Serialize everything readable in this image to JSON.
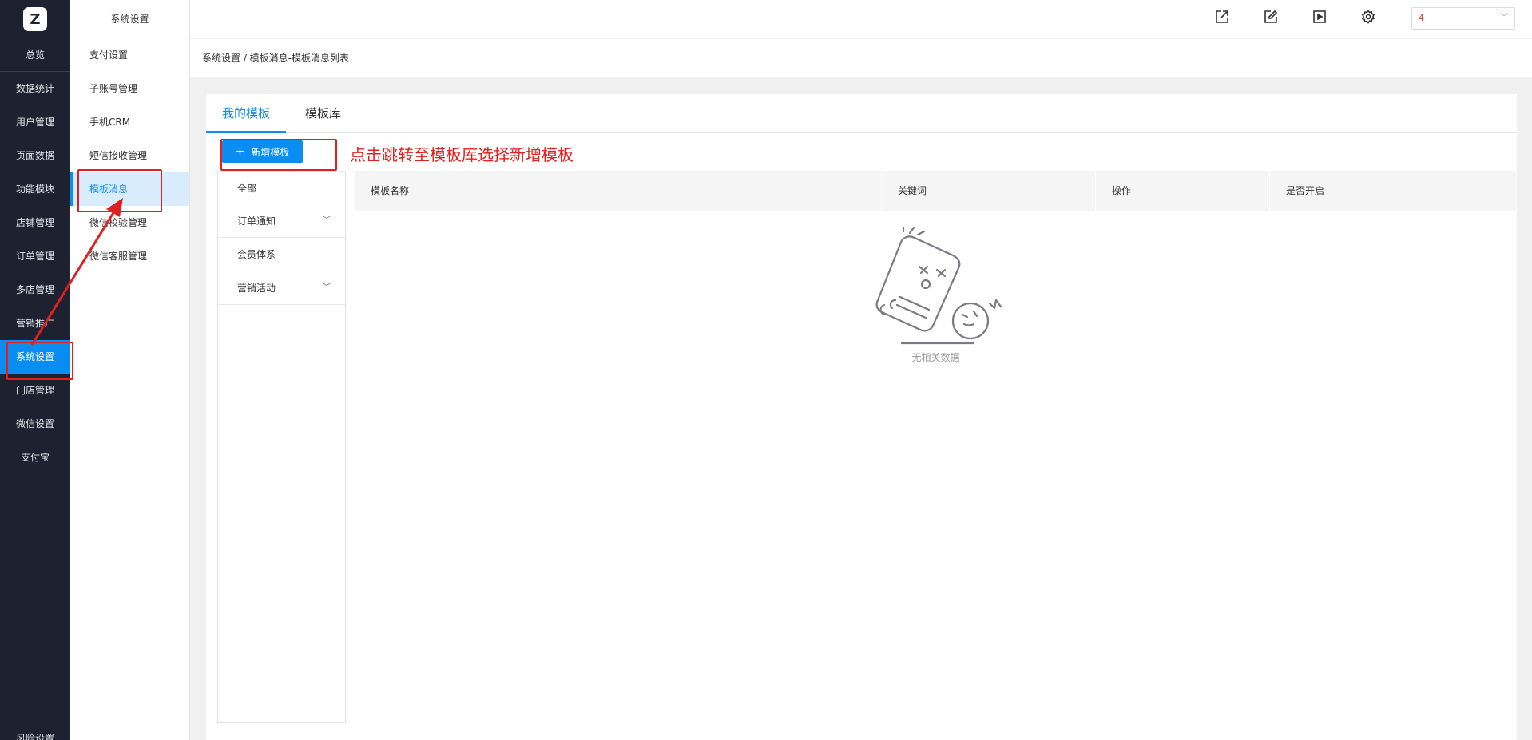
{
  "main_nav": {
    "logo_letter": "Z",
    "items": [
      {
        "label": "总览"
      },
      {
        "label": "数据统计"
      },
      {
        "label": "用户管理"
      },
      {
        "label": "页面数据"
      },
      {
        "label": "功能模块"
      },
      {
        "label": "店铺管理"
      },
      {
        "label": "订单管理"
      },
      {
        "label": "多店管理"
      },
      {
        "label": "营销推广"
      },
      {
        "label": "系统设置"
      },
      {
        "label": "门店管理"
      },
      {
        "label": "微信设置"
      },
      {
        "label": "支付宝"
      }
    ],
    "bottom_label": "风险设置"
  },
  "sub_nav": {
    "title": "系统设置",
    "items": [
      {
        "label": "支付设置"
      },
      {
        "label": "子账号管理"
      },
      {
        "label": "手机CRM"
      },
      {
        "label": "短信接收管理"
      },
      {
        "label": "模板消息"
      },
      {
        "label": "微信校验管理"
      },
      {
        "label": "微信客服管理"
      }
    ]
  },
  "header": {
    "icons": [
      "external-link-icon",
      "edit-icon",
      "play-icon",
      "gear-icon"
    ],
    "store_select_value": "4"
  },
  "breadcrumb": "系统设置 / 模板消息-模板消息列表",
  "tabs": [
    {
      "label": "我的模板"
    },
    {
      "label": "模板库"
    }
  ],
  "add_button": {
    "label": "新增模板"
  },
  "annotation_text": "点击跳转至模板库选择新增模板",
  "categories": [
    {
      "label": "全部",
      "expandable": false
    },
    {
      "label": "订单通知",
      "expandable": true
    },
    {
      "label": "会员体系",
      "expandable": false
    },
    {
      "label": "营销活动",
      "expandable": true
    }
  ],
  "table": {
    "columns": [
      "模板名称",
      "关键词",
      "操作",
      "是否开启"
    ],
    "rows": [],
    "empty_text": "无相关数据"
  },
  "colors": {
    "accent": "#0a8df0",
    "sidebar_bg": "#1e2230",
    "annotation_red": "#e02020"
  }
}
